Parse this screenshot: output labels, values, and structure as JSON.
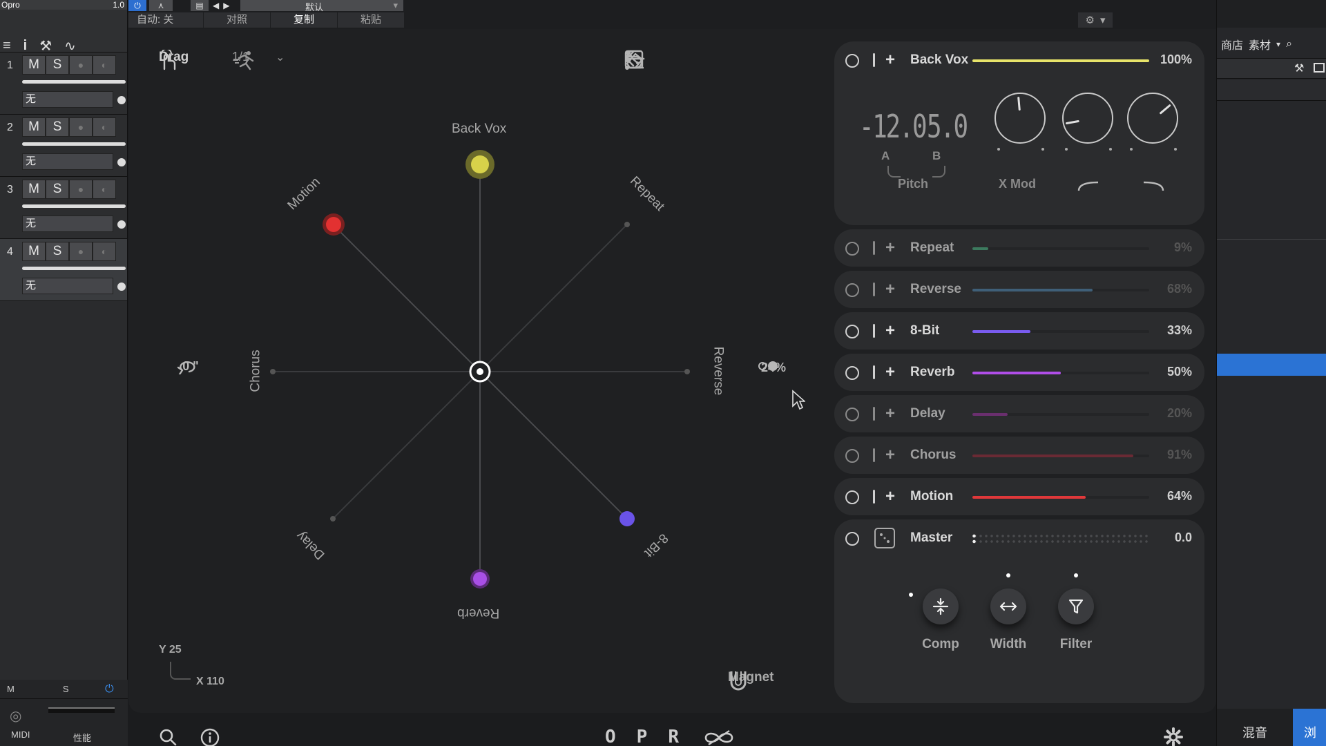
{
  "daw": {
    "left": {
      "top_title": "Opro",
      "top_value": "1.0",
      "tracks": [
        {
          "num": "1",
          "mute": "M",
          "solo": "S",
          "input": "无"
        },
        {
          "num": "2",
          "mute": "M",
          "solo": "S",
          "input": "无"
        },
        {
          "num": "3",
          "mute": "M",
          "solo": "S",
          "input": "无"
        },
        {
          "num": "4",
          "mute": "M",
          "solo": "S",
          "input": "无"
        }
      ],
      "bottom": {
        "m": "M",
        "s": "S",
        "midi": "MIDI",
        "perf": "性能"
      }
    },
    "top": {
      "preset": "默认",
      "auto": "自动: 关",
      "compare": "对照",
      "copy": "复制",
      "paste": "粘贴"
    },
    "right": {
      "shop": "商店",
      "material": "素材",
      "mix": "混音",
      "tab_partial": "浏"
    }
  },
  "plugin": {
    "toolbar": {
      "drag_label": "Drag",
      "ratio": "1/1"
    },
    "stage": {
      "labels": {
        "back_vox": "Back Vox",
        "repeat": "Repeat",
        "reverse": "Reverse",
        "bit": "8-Bit",
        "reverb": "Reverb",
        "delay": "Delay",
        "chorus": "Chorus",
        "motion": "Motion"
      },
      "rotation": "0 \"",
      "spread": "24%",
      "coord_y": "Y 25",
      "coord_x": "X 110",
      "magnet": "Magnet"
    },
    "slots": [
      {
        "name": "Back Vox",
        "value": 100,
        "pct": "100%",
        "color": "#e8e46a",
        "dim": false
      },
      {
        "name": "Repeat",
        "value": 9,
        "pct": "9%",
        "color": "#3c7a5e",
        "dim": true
      },
      {
        "name": "Reverse",
        "value": 68,
        "pct": "68%",
        "color": "#3f5f78",
        "dim": true
      },
      {
        "name": "8-Bit",
        "value": 33,
        "pct": "33%",
        "color": "#7a5cf0",
        "dim": false
      },
      {
        "name": "Reverb",
        "value": 50,
        "pct": "50%",
        "color": "#b04ee8",
        "dim": false
      },
      {
        "name": "Delay",
        "value": 20,
        "pct": "20%",
        "color": "#6a2f6e",
        "dim": true
      },
      {
        "name": "Chorus",
        "value": 91,
        "pct": "91%",
        "color": "#6a2a34",
        "dim": true
      },
      {
        "name": "Motion",
        "value": 64,
        "pct": "64%",
        "color": "#e0383a",
        "dim": false
      }
    ],
    "back_vox_detail": {
      "pitch_a": "-12.0",
      "pitch_b": "5.0",
      "label_a": "A",
      "label_b": "B",
      "pitch_label": "Pitch",
      "xmod_label": "X Mod"
    },
    "master": {
      "name": "Master",
      "value": "0.0",
      "comp": "Comp",
      "width": "Width",
      "filter": "Filter"
    },
    "bottom": {
      "o": "O",
      "p": "P",
      "r": "R"
    }
  }
}
